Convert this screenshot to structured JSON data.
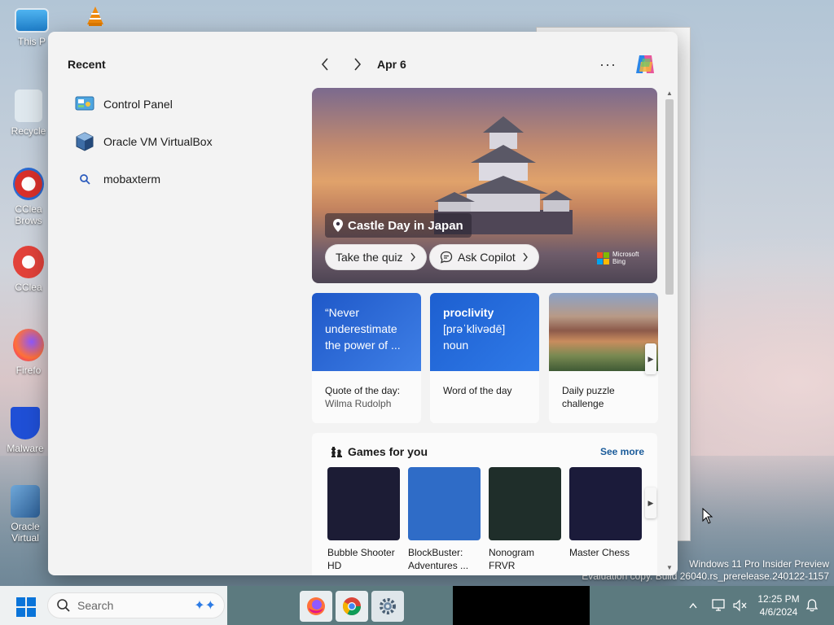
{
  "desktop": {
    "icons": [
      {
        "label": "This P"
      },
      {
        "label": "Recycle"
      },
      {
        "label": "CClea Brows"
      },
      {
        "label": "CClea"
      },
      {
        "label": "Firefo"
      },
      {
        "label": "Malware"
      },
      {
        "label": "Oracle Virtual"
      }
    ],
    "watermark_line1": "Windows 11 Pro Insider Preview",
    "watermark_line2": "Evaluation copy. Build 26040.rs_prerelease.240122-1157"
  },
  "widgets": {
    "recent_title": "Recent",
    "recent_items": [
      {
        "label": "Control Panel",
        "icon": "control-panel-icon"
      },
      {
        "label": "Oracle VM VirtualBox",
        "icon": "virtualbox-icon"
      },
      {
        "label": "mobaxterm",
        "icon": "search-icon"
      }
    ],
    "feed_date": "Apr 6",
    "more_label": "···",
    "hero": {
      "place": "Castle Day in Japan",
      "quiz_label": "Take the quiz",
      "copilot_label": "Ask Copilot",
      "brand_line1": "Microsoft",
      "brand_line2": "Bing"
    },
    "cards": [
      {
        "top_text": "“Never underestimate the power of ...",
        "title": "Quote of the day:",
        "subtitle": "Wilma Rudolph"
      },
      {
        "top_word": "proclivity",
        "top_pron": "[prəˈklivədē]",
        "top_pos": "noun",
        "title": "Word of the day"
      },
      {
        "title": "Daily puzzle challenge"
      }
    ],
    "games": {
      "title": "Games for you",
      "see_more": "See more",
      "items": [
        {
          "name": "Bubble Shooter HD",
          "color": "#1c1c35"
        },
        {
          "name": "BlockBuster: Adventures ...",
          "color": "#2f6cc7"
        },
        {
          "name": "Nonogram FRVR",
          "color": "#1f2e2a"
        },
        {
          "name": "Master Chess",
          "color": "#1b1b3a"
        }
      ]
    }
  },
  "taskbar": {
    "search_placeholder": "Search",
    "time": "12:25 PM",
    "date": "4/6/2024"
  }
}
